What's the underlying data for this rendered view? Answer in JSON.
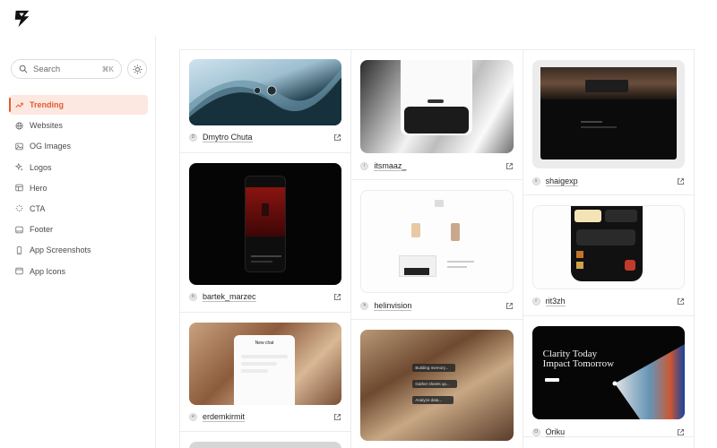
{
  "app": {
    "logo_icon": "lightning-logo-icon"
  },
  "search": {
    "placeholder": "Search",
    "shortcut": "⌘K"
  },
  "theme_toggle": {
    "icon": "sun-icon"
  },
  "accent": "#e35b2f",
  "nav": [
    {
      "label": "Trending",
      "icon": "trending-icon",
      "active": true
    },
    {
      "label": "Websites",
      "icon": "globe-icon"
    },
    {
      "label": "OG Images",
      "icon": "image-icon"
    },
    {
      "label": "Logos",
      "icon": "sparkles-icon"
    },
    {
      "label": "Hero",
      "icon": "layout-icon"
    },
    {
      "label": "CTA",
      "icon": "cursor-sparkle-icon"
    },
    {
      "label": "Footer",
      "icon": "footer-icon"
    },
    {
      "label": "App Screenshots",
      "icon": "phone-icon"
    },
    {
      "label": "App Icons",
      "icon": "app-window-icon"
    }
  ],
  "columns": [
    [
      {
        "author": "Dmytro Chuta",
        "initial": "D"
      },
      {
        "author": "bartek_marzec",
        "initial": "b"
      },
      {
        "author": "erdemkirmit",
        "initial": "e"
      }
    ],
    [
      {
        "author": "itsmaaz_",
        "initial": "i"
      },
      {
        "author": "helinvision",
        "initial": "h"
      }
    ],
    [
      {
        "author": "shaigexp",
        "initial": "s"
      },
      {
        "author": "rit3zh",
        "initial": "r"
      },
      {
        "author": "Oriku",
        "initial": "O"
      }
    ]
  ],
  "preview_text": {
    "chat_title": "New chat",
    "hero_headline_1": "Clarity Today",
    "hero_headline_2": "Impact Tomorrow",
    "action_1": "Building memory...",
    "action_2": "Gather sheets up...",
    "action_3": "Analyze data..."
  }
}
